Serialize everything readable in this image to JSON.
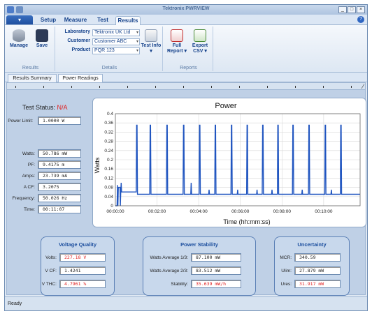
{
  "window": {
    "title": "Tektronix PWRVIEW"
  },
  "menu": {
    "file_label": "",
    "tabs": [
      "Setup",
      "Measure",
      "Test",
      "Results"
    ],
    "active_tab": "Results"
  },
  "ribbon": {
    "results_group": {
      "label": "Results",
      "manage_label": "Manage",
      "save_label": "Save"
    },
    "details_group": {
      "label": "Details",
      "laboratory_label": "Laboratory",
      "laboratory_value": "Tektronix UK Ltd",
      "customer_label": "Customer",
      "customer_value": "Customer ABC",
      "product_label": "Product",
      "product_value": "PQR 123",
      "test_info_label": "Test Info"
    },
    "reports_group": {
      "label": "Reports",
      "full_report_label": "Full Report",
      "export_csv_label": "Export CSV"
    }
  },
  "view_tabs": [
    "Results Summary",
    "Power Readings"
  ],
  "active_view_tab": "Power Readings",
  "test_status": {
    "label": "Test Status:",
    "value": "N/A"
  },
  "power_limit": {
    "label": "Power Limit:",
    "value": "1.0000 W"
  },
  "readings": [
    {
      "label": "Watts:",
      "value": "50.786 mW"
    },
    {
      "label": "PF:",
      "value": "9.4175 m"
    },
    {
      "label": "Amps:",
      "value": "23.739 mA"
    },
    {
      "label": "A CF:",
      "value": "3.2075"
    },
    {
      "label": "Frequency:",
      "value": "50.026 Hz"
    },
    {
      "label": "Time:",
      "value": "00:11:07"
    }
  ],
  "chart_data": {
    "type": "line",
    "title": "Power",
    "xlabel": "Time (hh:mm:ss)",
    "ylabel": "Watts",
    "ylim": [
      0,
      0.4
    ],
    "xlim": [
      0,
      11.75
    ],
    "yticks": [
      0,
      0.04,
      0.08,
      0.12,
      0.16,
      0.2,
      0.24,
      0.28,
      0.32,
      0.36,
      0.4
    ],
    "ytick_labels": [
      "0",
      "0.04",
      "0.08",
      "0.12",
      "0.16",
      "0.2",
      "0.24",
      "0.28",
      "0.32",
      "0.36",
      "0.4"
    ],
    "xticks": [
      0,
      2,
      4,
      6,
      8,
      10
    ],
    "xtick_labels": [
      "00:00:00",
      "00:02:00",
      "00:04:00",
      "00:06:00",
      "00:08:00",
      "00:10:00"
    ],
    "grid": true,
    "x_unit": "minutes",
    "baseline": 0.05,
    "series": [
      {
        "name": "",
        "x": [
          0.0,
          0.08,
          0.1,
          0.12,
          0.14,
          0.22,
          0.24,
          0.26,
          0.28,
          0.3,
          1.0,
          1.02,
          1.04,
          1.06,
          1.65,
          1.67,
          1.69,
          1.71,
          2.45,
          2.47,
          2.49,
          2.51,
          3.25,
          3.27,
          3.29,
          3.31,
          3.62,
          3.64,
          3.66,
          4.02,
          4.04,
          4.06,
          4.08,
          4.48,
          4.5,
          4.52,
          4.77,
          4.79,
          4.81,
          4.83,
          5.55,
          5.57,
          5.59,
          5.61,
          5.85,
          5.87,
          5.89,
          6.3,
          6.32,
          6.34,
          6.36,
          6.78,
          6.8,
          6.82,
          7.05,
          7.07,
          7.09,
          7.11,
          7.5,
          7.52,
          7.54,
          7.78,
          7.8,
          7.82,
          7.84,
          8.5,
          8.52,
          8.54,
          8.56,
          8.95,
          8.97,
          8.99,
          9.27,
          9.29,
          9.31,
          9.33,
          10.05,
          10.07,
          10.09,
          10.11,
          10.35,
          10.37,
          10.39,
          10.8,
          10.82,
          10.84,
          10.86,
          11.75
        ],
        "y": [
          0.0,
          0.0,
          0.09,
          0.0,
          0.08,
          0.08,
          0.0,
          0.06,
          0.1,
          0.06,
          0.06,
          0.35,
          0.35,
          0.05,
          0.05,
          0.35,
          0.35,
          0.05,
          0.05,
          0.35,
          0.35,
          0.05,
          0.05,
          0.35,
          0.35,
          0.05,
          0.05,
          0.1,
          0.05,
          0.05,
          0.35,
          0.35,
          0.05,
          0.05,
          0.07,
          0.05,
          0.05,
          0.35,
          0.35,
          0.05,
          0.05,
          0.35,
          0.35,
          0.05,
          0.05,
          0.07,
          0.05,
          0.05,
          0.35,
          0.35,
          0.05,
          0.05,
          0.07,
          0.05,
          0.05,
          0.35,
          0.35,
          0.05,
          0.05,
          0.07,
          0.05,
          0.05,
          0.35,
          0.35,
          0.05,
          0.05,
          0.35,
          0.35,
          0.05,
          0.05,
          0.07,
          0.05,
          0.05,
          0.35,
          0.35,
          0.05,
          0.05,
          0.35,
          0.35,
          0.05,
          0.05,
          0.07,
          0.05,
          0.05,
          0.35,
          0.35,
          0.05,
          0.05
        ]
      }
    ],
    "colors": {
      "line": "#2055c0",
      "grid": "#d8d8d8"
    }
  },
  "voltage_quality": {
    "title": "Voltage Quality",
    "rows": [
      {
        "label": "Volts:",
        "value": "227.18 V",
        "alert": true
      },
      {
        "label": "V CF:",
        "value": "1.4241",
        "alert": false
      },
      {
        "label": "V THC:",
        "value": "4.7961 %",
        "alert": true
      }
    ]
  },
  "power_stability": {
    "title": "Power Stability",
    "rows": [
      {
        "label": "Watts Average 1/3:",
        "value": "87.100 mW",
        "alert": false
      },
      {
        "label": "Watts Average 2/3:",
        "value": "83.512 mW",
        "alert": false
      },
      {
        "label": "Stability:",
        "value": "35.639 mW/h",
        "alert": true
      }
    ]
  },
  "uncertainty": {
    "title": "Uncertainty",
    "rows": [
      {
        "label": "MCR:",
        "value": "340.59",
        "alert": false
      },
      {
        "label": "Ulim:",
        "value": "27.879 mW",
        "alert": false
      },
      {
        "label": "Ures:",
        "value": "31.917 mW",
        "alert": true
      }
    ]
  },
  "status_bar": {
    "text": "Ready"
  },
  "theme": {
    "accent": "#15428b",
    "alert": "#e02020",
    "panel": "#bfd0e6"
  }
}
